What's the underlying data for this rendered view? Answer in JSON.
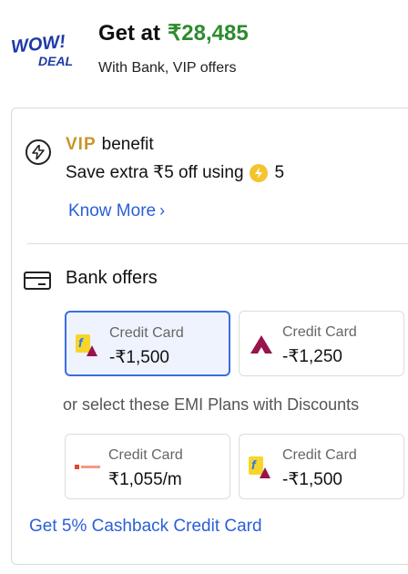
{
  "header": {
    "badge": {
      "line1": "WOW!",
      "line2": "DEAL"
    },
    "get_at_label": "Get at",
    "price": "₹28,485",
    "subtitle": "With Bank, VIP offers"
  },
  "vip": {
    "icon": "lightning-circle-icon",
    "brand": "VIP",
    "benefit_label": "benefit",
    "save_text": "Save extra ₹5 off using",
    "coin_count": "5",
    "know_more": "Know More",
    "know_more_chevron": "›"
  },
  "bank_offers": {
    "icon": "card-icon",
    "title": "Bank offers",
    "offers": [
      {
        "label": "Credit Card",
        "amount": "-₹1,500",
        "logo": "flipkart-axis-logo",
        "selected": true
      },
      {
        "label": "Credit Card",
        "amount": "-₹1,250",
        "logo": "axis-logo",
        "selected": false
      }
    ],
    "emi_text": "or select these EMI Plans with Discounts",
    "emi_offers": [
      {
        "label": "Credit Card",
        "amount": "₹1,055/m",
        "logo": "bank-logo-red"
      },
      {
        "label": "Credit Card",
        "amount": "-₹1,500",
        "logo": "flipkart-axis-logo"
      }
    ],
    "cashback_link": "Get 5% Cashback Credit Card"
  },
  "colors": {
    "price_green": "#2e8b2e",
    "link_blue": "#2b5fd9",
    "selected_border": "#3a6ee0",
    "badge_blue": "#1e3aa8",
    "axis_maroon": "#97144d"
  }
}
